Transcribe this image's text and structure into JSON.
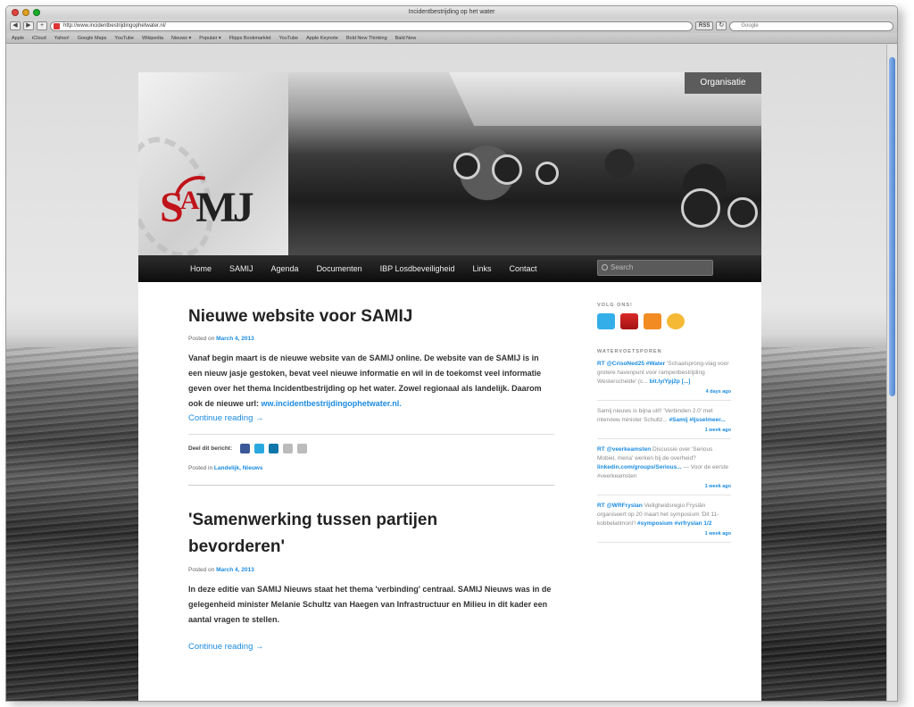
{
  "browser": {
    "title": "Incidentbestrijding op het water",
    "url": "http://www.incidentbestrijdingophetwater.nl/",
    "search_placeholder": "Google",
    "rss_label": "RSS",
    "bookmarks": [
      "Apple",
      "iCloud",
      "Yahoo!",
      "Google Maps",
      "YouTube",
      "Wikipedia",
      "Nieuws ▾",
      "Populair ▾",
      "Flipps Bookmarklet",
      "YouTube",
      "Apple Keynote",
      "Bold New Thinking",
      "Bald New"
    ]
  },
  "site": {
    "logo": {
      "s": "S",
      "a": "A",
      "mj": "MJ"
    },
    "org_button": "Organisatie",
    "nav": [
      "Home",
      "SAMIJ",
      "Agenda",
      "Documenten",
      "IBP Losdbeveiligheid",
      "Links",
      "Contact"
    ],
    "search_placeholder": "Search"
  },
  "posts": [
    {
      "title": "Nieuwe website voor SAMIJ",
      "posted_prefix": "Posted on",
      "date": "March 4, 2013",
      "body": "Vanaf begin maart is de nieuwe website van de SAMIJ online. De website van de SAMIJ is in een nieuw jasje gestoken, bevat veel nieuwe informatie en wil in de toekomst veel informatie geven over het thema Incidentbestrijding op het water. Zowel regionaal als landelijk. Daarom ook de nieuwe url:",
      "link": "ww.incidentbestrijdingophetwater.nl.",
      "more": "Continue reading →",
      "share_label": "Deel dit bericht:",
      "meta_prefix": "Posted in",
      "meta_links": "Landelijk, Nieuws"
    },
    {
      "title": "'Samenwerking tussen partijen bevorderen'",
      "posted_prefix": "Posted on",
      "date": "March 4, 2013",
      "body": "In deze editie van SAMIJ Nieuws staat het thema 'verbinding' centraal. SAMIJ Nieuws was in de gelegenheid minister Melanie Schultz van Haegen van Infrastructuur en Milieu in dit kader een aantal vragen te stellen.",
      "more": "Continue reading →"
    }
  ],
  "sidebar": {
    "follow_heading": "Volg ons!",
    "tweets_heading": "Watervoetsporen",
    "tweets": [
      {
        "handle": "RT @CrisoNed25",
        "tag": "#Water",
        "text": "'Schaalsprong-vlag voor grotere havenpunt voor rampenbestrijding Westerschelde' (c...",
        "link": "bit.ly/Ypj2p [...]",
        "ago": "4 days ago"
      },
      {
        "handle": "",
        "tag": "",
        "text": "Samij nieuws is bijna uit!! 'Verbinden 2.0' met interview minister Schultz...",
        "link": "#Samij #Ijsselmeer...",
        "ago": "1 week ago"
      },
      {
        "handle": "RT @veerkeamsten",
        "tag": "",
        "text": "Discussie over 'Serious Mobiel, mena' werken bij de overheid?",
        "link": "linkedin.com/groups/Serious...",
        "extra": "— Voor de eerste #veerkeamsten",
        "ago": "1 week ago"
      },
      {
        "handle": "RT @WRFryslan",
        "tag": "",
        "text": "Veiligheidsregio Fryslân organiseert op 20 maart het symposium 'Dit 11-kobbelatimoni'!",
        "link": "#symposium #vrfryslan 1/2",
        "ago": "1 week ago"
      }
    ]
  },
  "colors": {
    "accent": "#1b8be0",
    "nav_bg": "#111111",
    "logo_red": "#c0141a"
  }
}
